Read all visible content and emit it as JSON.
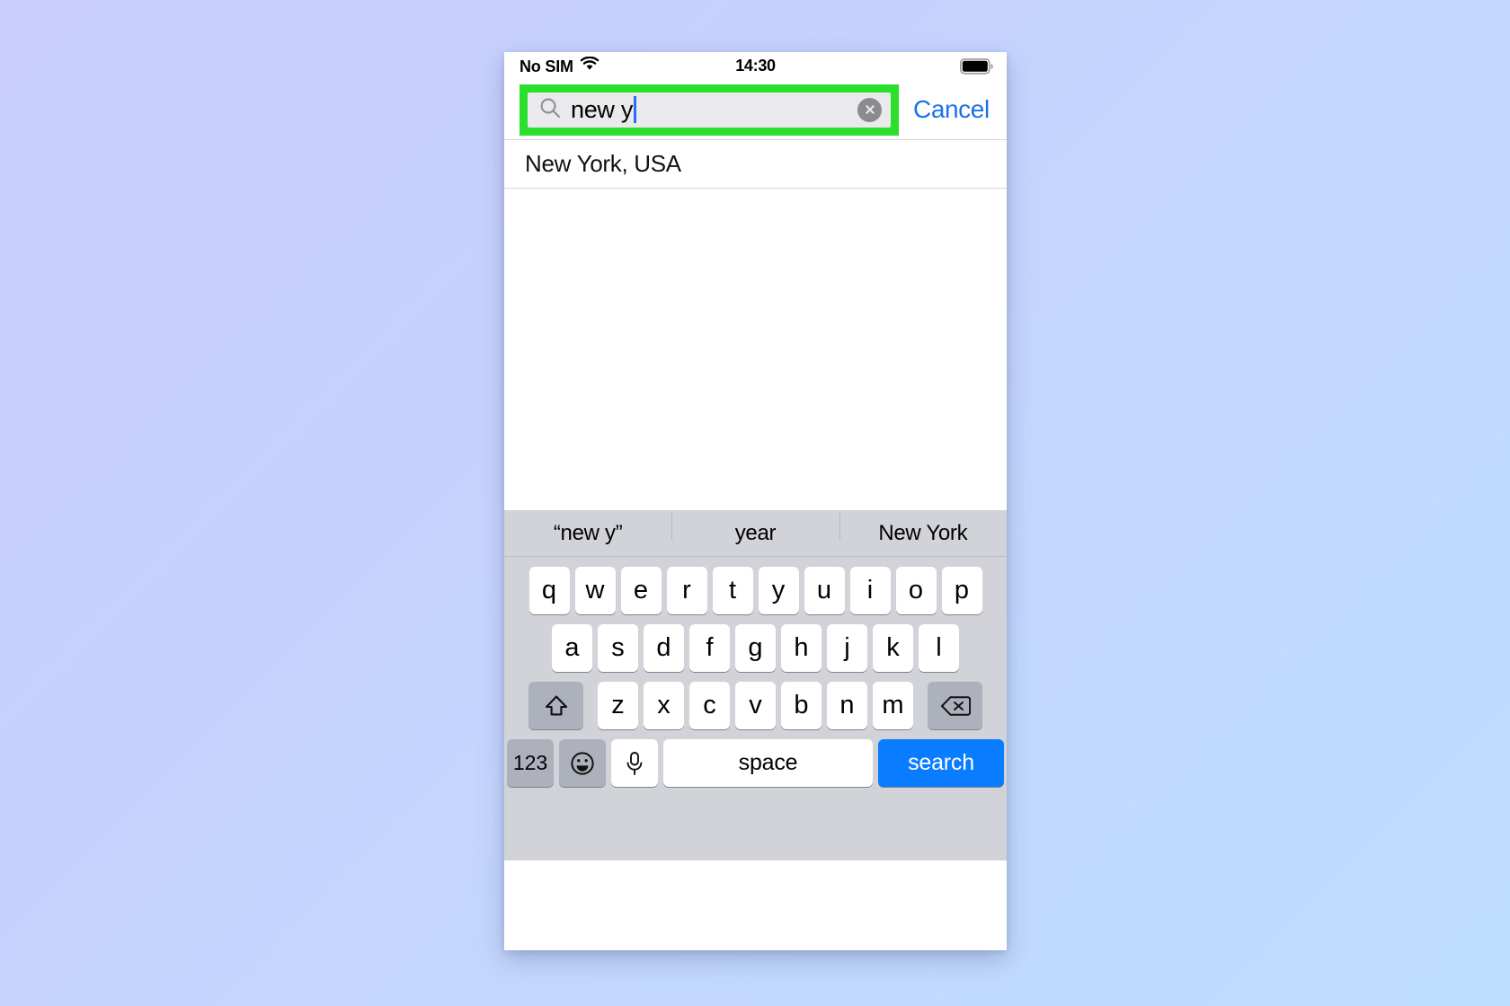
{
  "status_bar": {
    "carrier": "No SIM",
    "time": "14:30",
    "wifi_icon": "wifi-icon",
    "battery_icon": "battery-full-icon"
  },
  "search": {
    "value": "new y",
    "placeholder": "Search",
    "search_icon": "search-icon",
    "clear_icon": "clear-circle-icon",
    "cancel_label": "Cancel",
    "highlight_color": "#2ae02a",
    "field_bg": "#eaeaec",
    "caret_color": "#2b6cf5"
  },
  "results": {
    "rows": [
      {
        "label": "New York, USA"
      }
    ]
  },
  "keyboard": {
    "suggestions": [
      {
        "label": "“new y”"
      },
      {
        "label": "year"
      },
      {
        "label": "New York"
      }
    ],
    "row1": [
      "q",
      "w",
      "e",
      "r",
      "t",
      "y",
      "u",
      "i",
      "o",
      "p"
    ],
    "row2": [
      "a",
      "s",
      "d",
      "f",
      "g",
      "h",
      "j",
      "k",
      "l"
    ],
    "row3": [
      "z",
      "x",
      "c",
      "v",
      "b",
      "n",
      "m"
    ],
    "shift_icon": "shift-up-arrow-icon",
    "backspace_icon": "backspace-delete-icon",
    "numbers_label": "123",
    "emoji_icon": "emoji-smiley-icon",
    "dictation_icon": "microphone-icon",
    "space_label": "space",
    "return_label": "search",
    "return_color": "#0a7cff",
    "keyboard_bg": "#d1d3d9"
  }
}
